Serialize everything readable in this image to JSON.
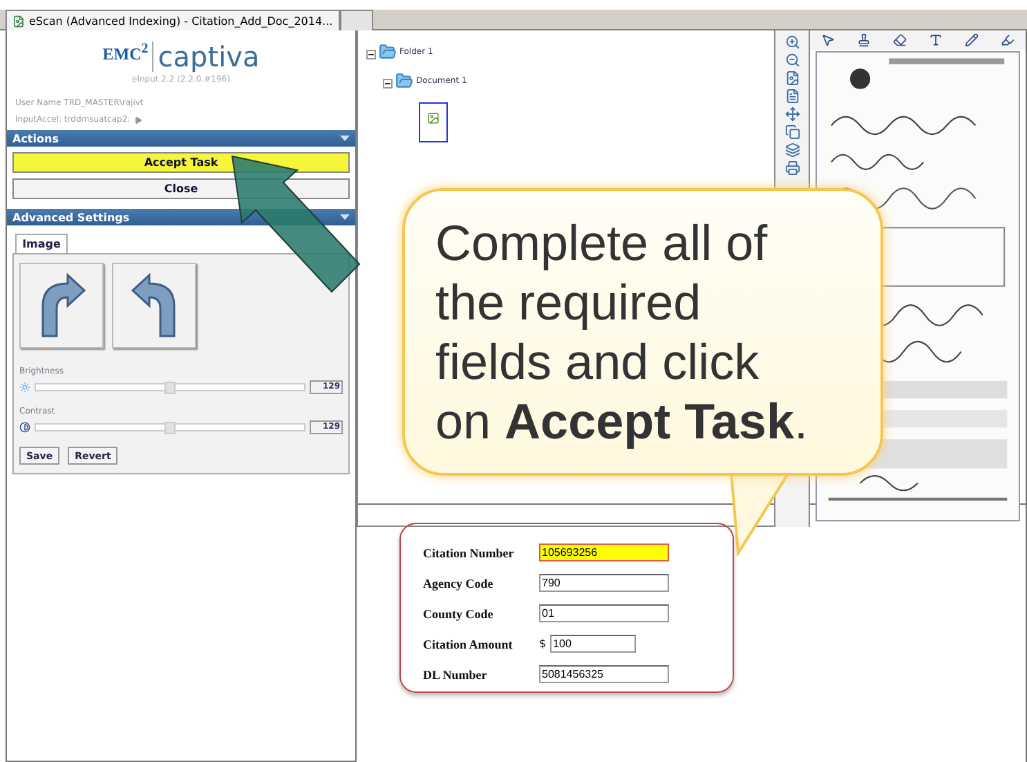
{
  "window": {
    "tab_title": "eScan (Advanced Indexing) - Citation_Add_Doc_2014..."
  },
  "logo": {
    "brand": "EMC",
    "superscript": "2",
    "product": "captiva",
    "version": "eInput 2.2  (2.2.0.#196)"
  },
  "session": {
    "user": "User Name TRD_MASTER\\rajivt",
    "server": "InputAccel: trddmsuatcap2:"
  },
  "actions": {
    "title": "Actions",
    "expanded": true,
    "buttons": [
      {
        "label": "Accept Task",
        "highlighted": true
      },
      {
        "label": "Close",
        "highlighted": false
      }
    ]
  },
  "advanced_settings": {
    "title": "Advanced Settings",
    "expanded": true,
    "tabs": [
      {
        "label": "Image",
        "selected": true
      }
    ],
    "sliders": [
      {
        "label": "Brightness",
        "kind": "sun",
        "level": 0.5,
        "value": "129"
      },
      {
        "label": "Contrast",
        "kind": "contrast",
        "level": 0.5,
        "value": "129"
      }
    ],
    "buttons": [
      "Save",
      "Revert"
    ]
  },
  "tree": [
    {
      "label": "Folder 1",
      "expanded": true,
      "children": [
        {
          "label": "Document 1",
          "expanded": true,
          "children": [
            {
              "kind": "page",
              "selected": true
            }
          ]
        }
      ]
    }
  ],
  "form": {
    "fields": [
      {
        "label": "Citation Number",
        "value": "105693256",
        "highlighted": true
      },
      {
        "label": "Agency Code",
        "value": "790",
        "highlighted": false
      },
      {
        "label": "County Code",
        "value": "01",
        "highlighted": false
      },
      {
        "label": "Citation Amount",
        "prefix": "$",
        "value": "100",
        "highlighted": false
      },
      {
        "label": "DL Number",
        "value": "5081456325",
        "highlighted": false
      }
    ]
  },
  "callout": {
    "text": "Complete all of the required fields and click on **Accept Task**."
  }
}
